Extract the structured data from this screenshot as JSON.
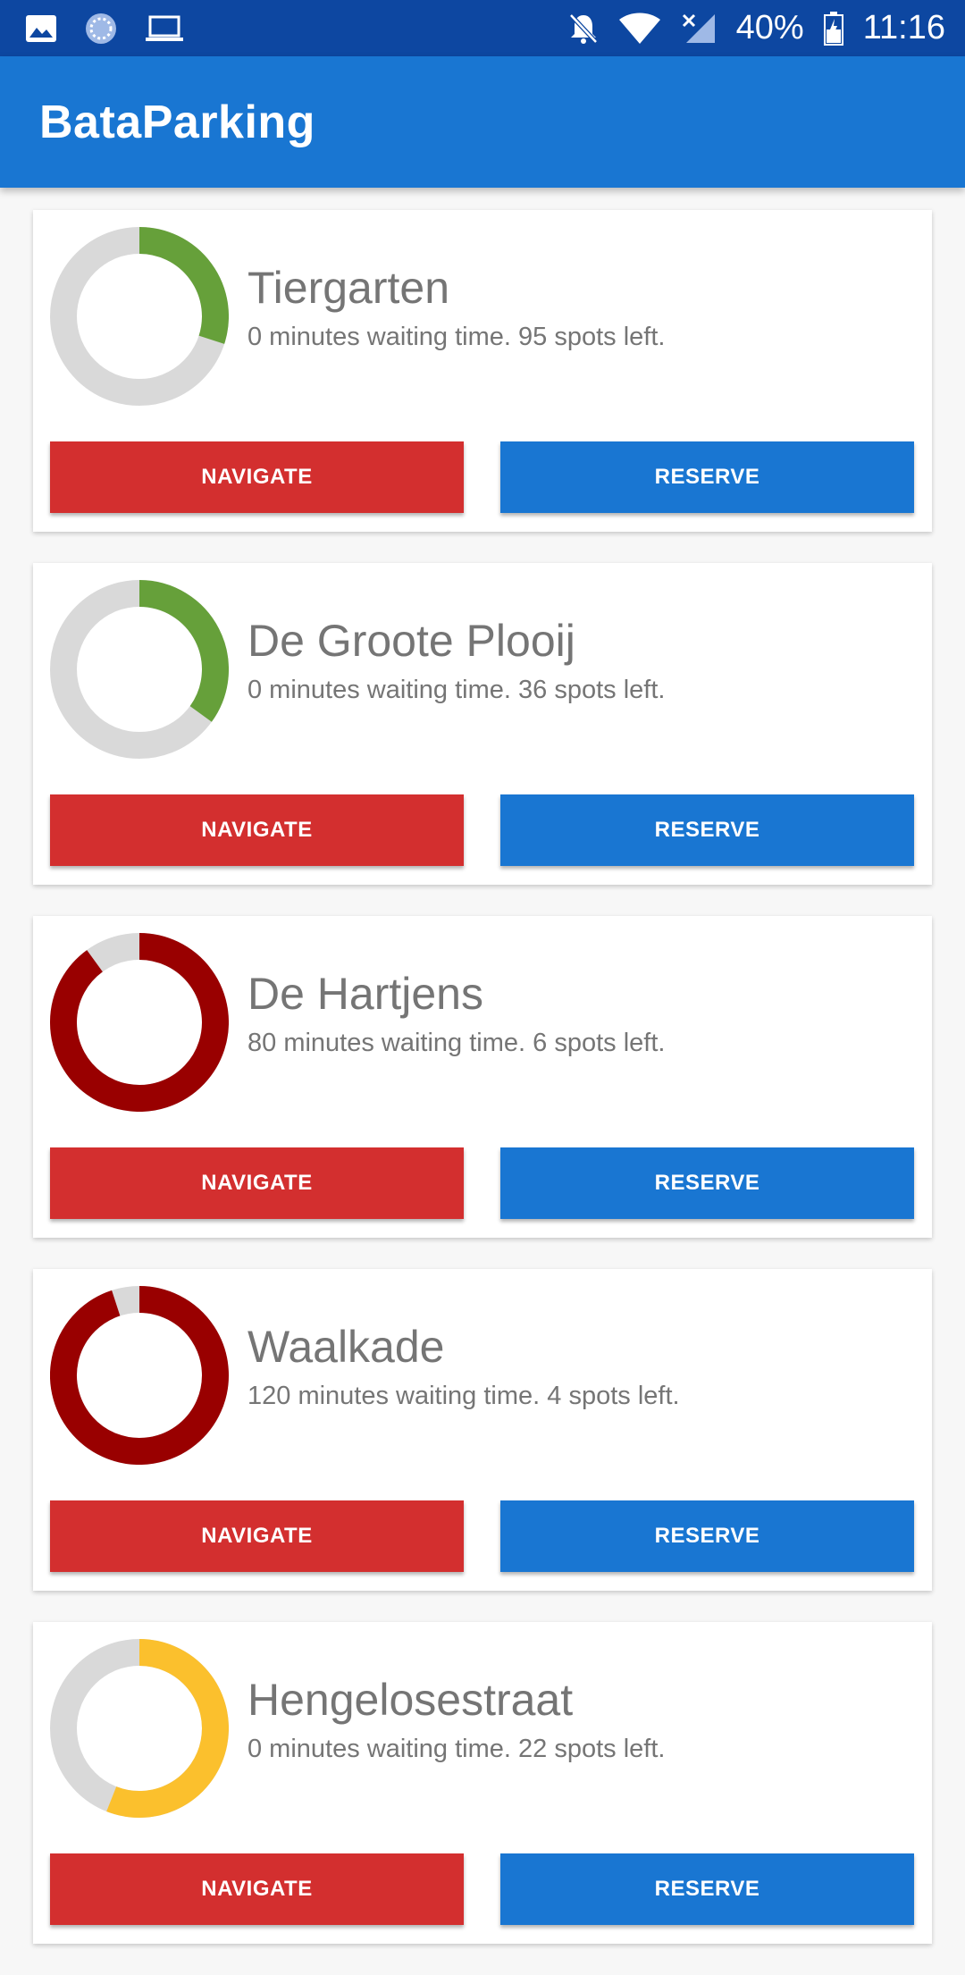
{
  "status_bar": {
    "icons_left": [
      "image-icon",
      "sync-icon",
      "laptop-icon"
    ],
    "icons_right": [
      "bell-off-icon",
      "wifi-icon",
      "signal-icon",
      "battery-icon"
    ],
    "battery": "40%",
    "time": "11:16"
  },
  "app_bar": {
    "title": "BataParking"
  },
  "colors": {
    "status_bar": "#0d47a1",
    "app_bar": "#1976d2",
    "navigate_button": "#d32f2f",
    "reserve_button": "#1976d2",
    "gauge_track": "#d9d9d9",
    "gauge_green": "#66a03a",
    "gauge_red": "#990000",
    "gauge_yellow": "#fbc02d"
  },
  "parkings": [
    {
      "name": "Tiergarten",
      "info": "0 minutes waiting time.  95 spots left.",
      "occupancy": 0.3,
      "color": "#66a03a",
      "navigate_label": "NAVIGATE",
      "reserve_label": "RESERVE"
    },
    {
      "name": "De Groote Plooij",
      "info": "0 minutes waiting time.  36 spots left.",
      "occupancy": 0.35,
      "color": "#66a03a",
      "navigate_label": "NAVIGATE",
      "reserve_label": "RESERVE"
    },
    {
      "name": "De Hartjens",
      "info": "80 minutes waiting time.  6 spots left.",
      "occupancy": 0.9,
      "color": "#990000",
      "navigate_label": "NAVIGATE",
      "reserve_label": "RESERVE"
    },
    {
      "name": "Waalkade",
      "info": "120 minutes waiting time.  4 spots left.",
      "occupancy": 0.95,
      "color": "#990000",
      "navigate_label": "NAVIGATE",
      "reserve_label": "RESERVE"
    },
    {
      "name": "Hengelosestraat",
      "info": "0 minutes waiting time.  22 spots left.",
      "occupancy": 0.56,
      "color": "#fbc02d",
      "navigate_label": "NAVIGATE",
      "reserve_label": "RESERVE"
    }
  ]
}
